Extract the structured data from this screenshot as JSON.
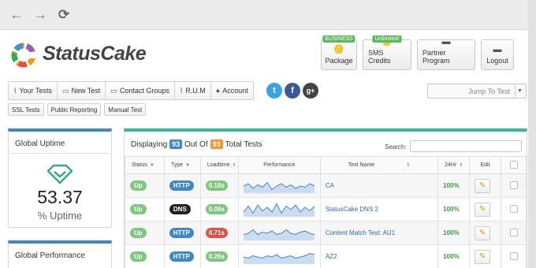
{
  "brand": {
    "name": "StatusCake"
  },
  "top_buttons": [
    {
      "label": "Package",
      "tag": "BUSINESS",
      "icon": "coins-icon"
    },
    {
      "label": "SMS Credits",
      "tag": "Unlimited!",
      "icon": "coins-icon"
    },
    {
      "label": "Partner Program",
      "tag": "",
      "icon": "comment-icon"
    },
    {
      "label": "Logout",
      "tag": "",
      "icon": "comment-icon"
    }
  ],
  "menu": [
    {
      "label": "Your Tests",
      "icon": "chart-icon"
    },
    {
      "label": "New Test",
      "icon": "monitor-icon"
    },
    {
      "label": "Contact Groups",
      "icon": "monitor-icon"
    },
    {
      "label": "R.U.M",
      "icon": "chart-icon"
    },
    {
      "label": "Account",
      "icon": "user-icon"
    }
  ],
  "social": {
    "twitter": "t",
    "facebook": "f",
    "google": "g+"
  },
  "jump": {
    "label": "Jump To Test"
  },
  "sub_menu": [
    "SSL Tests",
    "Public Reporting",
    "Manual Test"
  ],
  "uptime_panel": {
    "title": "Global Uptime",
    "value": "53.37",
    "unit": "% Uptime"
  },
  "performance_panel": {
    "title": "Global Performance"
  },
  "tests_panel": {
    "displaying": "Displaying",
    "shown": "93",
    "out_of": "Out Of",
    "total": "93",
    "total_tests": "Total Tests",
    "search_label": "Search:",
    "columns": [
      "Status",
      "Type",
      "Loadtime",
      "Performance",
      "Test Name",
      "24Hr",
      "Edit"
    ],
    "rows": [
      {
        "status": "Up",
        "type": "HTTP",
        "loadtime": "0.18s",
        "name": "CA",
        "uptime": "100%",
        "perf": [
          6,
          8,
          4,
          7,
          5,
          9,
          3,
          6,
          8,
          5,
          7,
          4,
          6,
          5,
          8,
          6
        ]
      },
      {
        "status": "Up",
        "type": "DNS",
        "loadtime": "0.06s",
        "name": "StatusCake DNS 2",
        "uptime": "100%",
        "perf": [
          4,
          9,
          3,
          10,
          5,
          8,
          4,
          11,
          3,
          9,
          6,
          10,
          4,
          8,
          5,
          9
        ]
      },
      {
        "status": "Up",
        "type": "HTTP",
        "loadtime": "0.71s",
        "name": "Content Match Test: AU1",
        "uptime": "100%",
        "perf": [
          5,
          6,
          9,
          5,
          7,
          6,
          8,
          5,
          6,
          9,
          6,
          5,
          7,
          8,
          6,
          5
        ]
      },
      {
        "status": "Up",
        "type": "HTTP",
        "loadtime": "0.26s",
        "name": "AZ2",
        "uptime": "100%",
        "perf": [
          6,
          5,
          7,
          6,
          5,
          7,
          6,
          8,
          5,
          6,
          7,
          5,
          6,
          7,
          9,
          8
        ]
      }
    ]
  },
  "colors": {
    "up": "#7fc67f",
    "http": "#3e88c7",
    "dns": "#222222",
    "load_fast": "#7fc67f",
    "load_slow": "#d9534f",
    "count_blue": "#3e88c7",
    "count_orange": "#f0962a"
  }
}
